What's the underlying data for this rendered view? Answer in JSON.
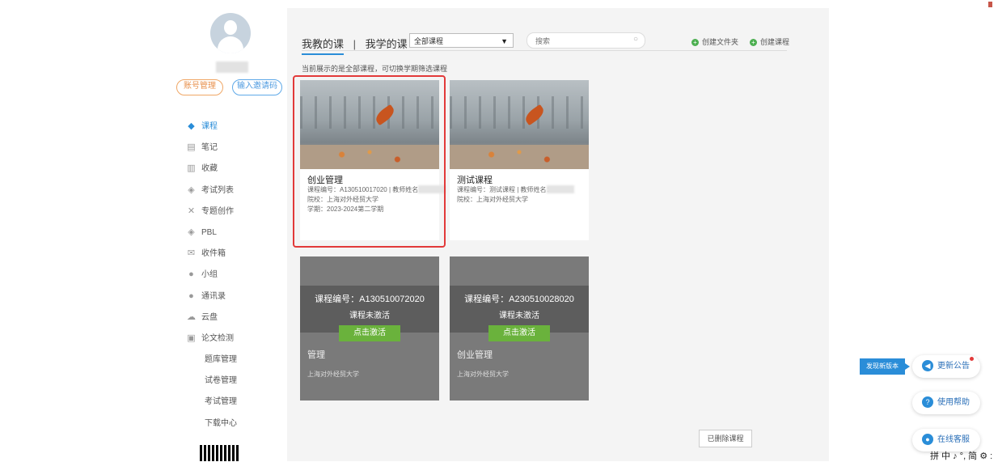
{
  "sidebar": {
    "account_btn": "账号管理",
    "invite_btn": "输入邀请码",
    "items": [
      {
        "label": "课程",
        "icon": "course-icon",
        "active": true
      },
      {
        "label": "笔记",
        "icon": "note-icon"
      },
      {
        "label": "收藏",
        "icon": "favorite-icon"
      },
      {
        "label": "考试列表",
        "icon": "exam-icon"
      },
      {
        "label": "专题创作",
        "icon": "topic-icon"
      },
      {
        "label": "PBL",
        "icon": "pbl-icon"
      },
      {
        "label": "收件箱",
        "icon": "inbox-icon"
      },
      {
        "label": "小组",
        "icon": "group-icon"
      },
      {
        "label": "通讯录",
        "icon": "contacts-icon"
      },
      {
        "label": "云盘",
        "icon": "cloud-icon"
      },
      {
        "label": "论文检测",
        "icon": "paper-check-icon"
      },
      {
        "label": "题库管理"
      },
      {
        "label": "试卷管理"
      },
      {
        "label": "考试管理"
      },
      {
        "label": "下载中心"
      }
    ]
  },
  "main": {
    "tab_teach": "我教的课",
    "tab_sep": "|",
    "tab_learn": "我学的课",
    "filter_value": "全部课程",
    "search_placeholder": "搜索",
    "create_folder": "创建文件夹",
    "create_course": "创建课程",
    "notice": "当前展示的是全部课程，可切换学期筛选课程",
    "courses": [
      {
        "title": "创业管理",
        "code_line": "课程编号：A130510017020 | 教师姓名：",
        "school_line": "院校：上海对外经贸大学",
        "term_line": "学期：2023-2024第二学期"
      },
      {
        "title": "测试课程",
        "code_line": "课程编号：测试课程 | 教师姓名：",
        "school_line": "院校：上海对外经贸大学"
      }
    ],
    "inactive_courses": [
      {
        "code": "课程编号：A130510072020",
        "status": "课程未激活",
        "activate": "点击激活",
        "title": "管理",
        "school": "上海对外经贸大学"
      },
      {
        "code": "课程编号：A230510028020",
        "status": "课程未激活",
        "activate": "点击激活",
        "title": "创业管理",
        "school": "上海对外经贸大学"
      }
    ],
    "deleted_btn": "已删除课程"
  },
  "float": {
    "new_version": "发现新版本",
    "update": "更新公告",
    "help": "使用帮助",
    "service": "在线客服"
  },
  "ime_text": "拼 中 ♪ °, 简 ⚙ :",
  "colors": {
    "accent": "#2a8dd8",
    "highlight": "#e23a3a",
    "activate_green": "#6ab23c"
  }
}
